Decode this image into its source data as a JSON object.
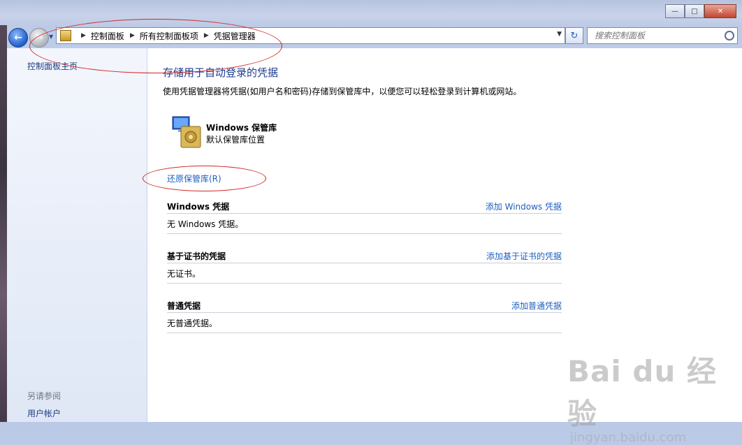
{
  "window": {
    "minimize_icon": "minimize-icon",
    "maximize_icon": "maximize-icon",
    "close_icon": "close-icon"
  },
  "nav": {
    "back_icon": "back-arrow-icon",
    "forward_icon": "forward-arrow-icon",
    "address": {
      "breadcrumbs": [
        "控制面板",
        "所有控制面板项",
        "凭据管理器"
      ]
    },
    "search": {
      "placeholder": "搜索控制面板"
    }
  },
  "sidebar": {
    "home_link": "控制面板主页",
    "see_also_header": "另请参阅",
    "see_also_items": [
      "用户帐户"
    ]
  },
  "main": {
    "title": "存储用于自动登录的凭据",
    "description": "使用凭据管理器将凭据(如用户名和密码)存储到保管库中，以便您可以轻松登录到计算机或网站。",
    "vault": {
      "name": "Windows 保管库",
      "subtitle": "默认保管库位置",
      "icon": "vault-safe-icon"
    },
    "restore_link": "还原保管库(R)",
    "sections": [
      {
        "title": "Windows 凭据",
        "add_link": "添加 Windows 凭据",
        "empty_text": "无 Windows 凭据。"
      },
      {
        "title": "基于证书的凭据",
        "add_link": "添加基于证书的凭据",
        "empty_text": "无证书。"
      },
      {
        "title": "普通凭据",
        "add_link": "添加普通凭据",
        "empty_text": "无普通凭据。"
      }
    ]
  },
  "watermark": {
    "logo": "Bai du 经验",
    "url": "jingyan.baidu.com"
  },
  "colors": {
    "link": "#1f5fbf",
    "title": "#1e3d8f",
    "annotation": "#d02828"
  }
}
